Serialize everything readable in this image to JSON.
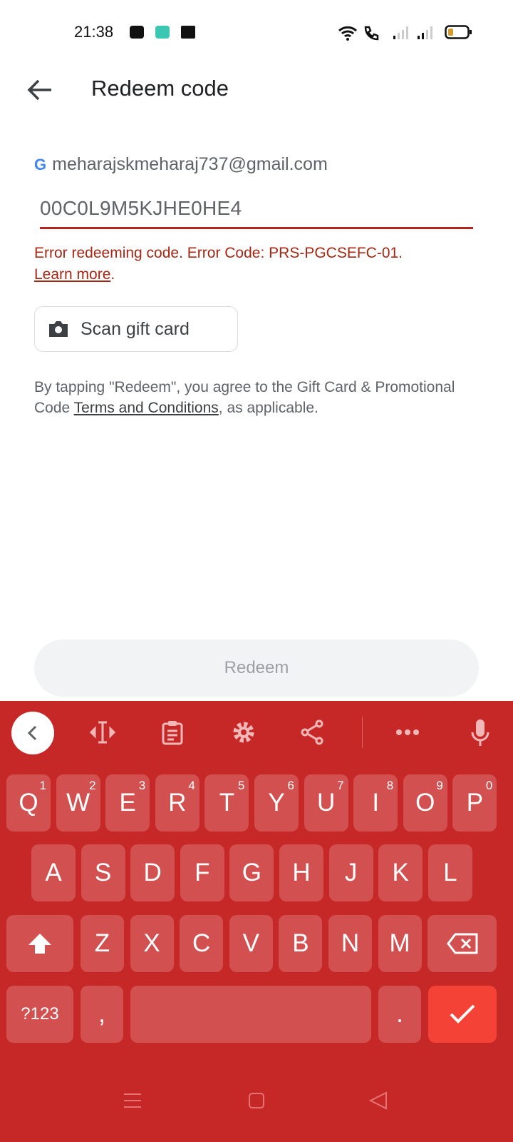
{
  "status_bar": {
    "time": "21:38",
    "left_icons": [
      "youtube-icon",
      "app-icon",
      "facebook-icon"
    ],
    "right_icons": [
      "wifi-icon",
      "wifi-call-icon",
      "signal-sim1-icon",
      "signal-sim2-icon",
      "battery-icon"
    ]
  },
  "header": {
    "title": "Redeem code",
    "back_icon": "arrow-left-icon"
  },
  "account": {
    "email": "meharajskmeharaj737@gmail.com",
    "logo": "G"
  },
  "code_input": {
    "value": "00C0L9M5KJHE0HE4"
  },
  "error": {
    "message": "Error redeeming code. Error Code: PRS-PGCSEFC-01.",
    "link": "Learn more",
    "suffix": "."
  },
  "scan_button": {
    "label": "Scan gift card",
    "icon": "camera-icon"
  },
  "terms": {
    "prefix": "By tapping \"Redeem\", you agree to the Gift Card & Promotional Code ",
    "link": "Terms and Conditions",
    "suffix": ", as applicable."
  },
  "redeem_button": {
    "label": "Redeem"
  },
  "keyboard": {
    "colors": {
      "background": "#c62828",
      "key": "#d35050",
      "enter": "#f44336"
    },
    "toolbar": [
      "chevron-left-icon",
      "cursor-move-icon",
      "clipboard-icon",
      "gear-icon",
      "share-icon",
      "more-icon",
      "microphone-icon"
    ],
    "row1": [
      {
        "k": "Q",
        "n": "1"
      },
      {
        "k": "W",
        "n": "2"
      },
      {
        "k": "E",
        "n": "3"
      },
      {
        "k": "R",
        "n": "4"
      },
      {
        "k": "T",
        "n": "5"
      },
      {
        "k": "Y",
        "n": "6"
      },
      {
        "k": "U",
        "n": "7"
      },
      {
        "k": "I",
        "n": "8"
      },
      {
        "k": "O",
        "n": "9"
      },
      {
        "k": "P",
        "n": "0"
      }
    ],
    "row2": [
      "A",
      "S",
      "D",
      "F",
      "G",
      "H",
      "J",
      "K",
      "L"
    ],
    "row3": [
      "Z",
      "X",
      "C",
      "V",
      "B",
      "N",
      "M"
    ],
    "symbols": "?123",
    "comma": ",",
    "period": "."
  },
  "nav_bar": [
    "menu-icon",
    "home-icon",
    "back-icon"
  ]
}
